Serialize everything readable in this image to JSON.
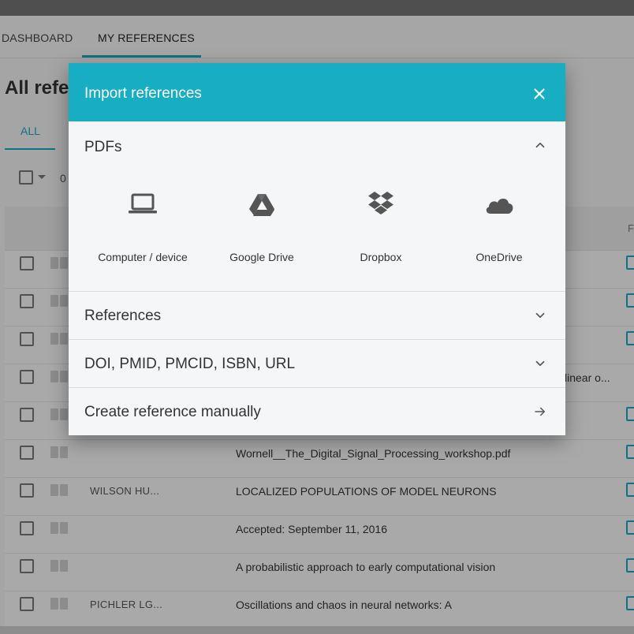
{
  "app": {
    "tabs": [
      {
        "label": "DASHBOARD"
      },
      {
        "label": "MY REFERENCES"
      }
    ],
    "page_heading": "All refer",
    "filter_tab": "ALL",
    "selection_count": "0",
    "table_header_right": "F",
    "rows": [
      {
        "author": "",
        "title": ""
      },
      {
        "author": "",
        "title": ""
      },
      {
        "author": "",
        "title": ""
      },
      {
        "author": "",
        "title": "linear o..."
      },
      {
        "author": "",
        "title": ""
      },
      {
        "author": "",
        "title": "Wornell__The_Digital_Signal_Processing_workshop.pdf"
      },
      {
        "author": "WILSON HU...",
        "title": "LOCALIZED POPULATIONS OF MODEL NEURONS"
      },
      {
        "author": "",
        "title": "Accepted: September 11, 2016"
      },
      {
        "author": "",
        "title": "A probabilistic approach to early computational vision"
      },
      {
        "author": "PICHLER LG...",
        "title": "Oscillations and chaos in neural networks: A"
      }
    ]
  },
  "dialog": {
    "title": "Import references",
    "close_icon": "close-icon",
    "pdfs": {
      "label": "PDFs",
      "state": "expanded",
      "sources": [
        {
          "label": "Computer / device",
          "icon": "laptop-icon"
        },
        {
          "label": "Google Drive",
          "icon": "google-drive-icon"
        },
        {
          "label": "Dropbox",
          "icon": "dropbox-icon"
        },
        {
          "label": "OneDrive",
          "icon": "onedrive-icon"
        }
      ]
    },
    "references": {
      "label": "References",
      "state": "collapsed"
    },
    "identifiers": {
      "label": "DOI, PMID, PMCID, ISBN, URL",
      "state": "collapsed"
    },
    "manual": {
      "label": "Create reference manually",
      "icon": "arrow-right-icon"
    }
  },
  "colors": {
    "accent": "#17aec4",
    "header_text": "#ffffff",
    "icon": "#555555"
  }
}
